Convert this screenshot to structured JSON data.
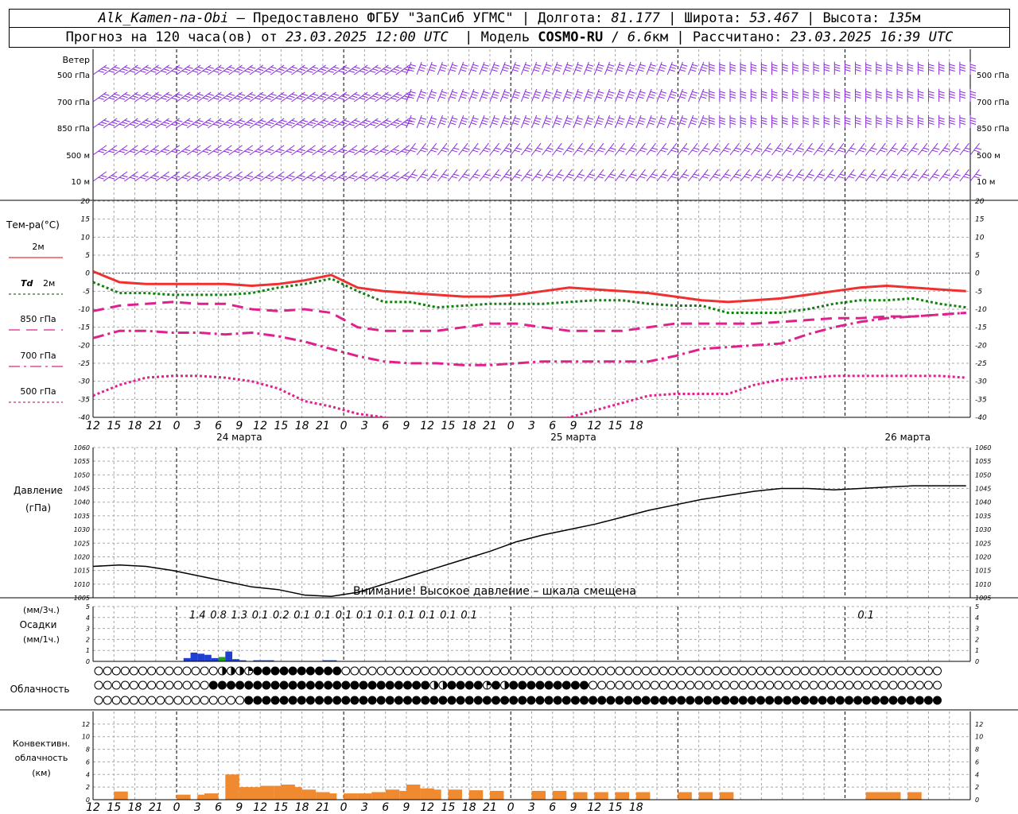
{
  "header": {
    "station": "Alk_Kamen-na-Obi",
    "provided": " – Предоставлено ФГБУ \"ЗапСиб УГМС\" | Долгота: ",
    "lon": "81.177",
    "lat_label": " | Широта: ",
    "lat": "53.467",
    "alt_label": " | Высота: ",
    "alt": "135",
    "alt_unit": "м",
    "forecast": "Прогноз на 120 часа(ов) от ",
    "run": "23.03.2025 12:00 UTC",
    "model_label": "  | Модель ",
    "model": "COSMO-RU",
    "model_sep": " / ",
    "res": "6.6",
    "res_unit": "км",
    "calc_label": " | Рассчитано: ",
    "calc": "23.03.2025 16:39 UTC"
  },
  "colors": {
    "wind": "#8a2be2",
    "t2m": "#f03030",
    "td2m": "#108010",
    "t850": "#e0208c",
    "t700": "#e0208c",
    "t500": "#e0208c",
    "zero_line": "#3050d0",
    "pressure": "#000000",
    "precip": "#1f3fd0",
    "precip_conv": "#20a020",
    "conv_cloud": "#f08a30",
    "grid": "#a8a8a8"
  },
  "chart_data": [
    {
      "type": "wind-barbs",
      "title": "Ветер",
      "levels": [
        "500 гПа",
        "700 гПа",
        "850 гПа",
        "500 м",
        "10 м"
      ],
      "x_hours": [
        12,
        15,
        18,
        21,
        0,
        3,
        6,
        9,
        12,
        15,
        18,
        21,
        0,
        3,
        6,
        9,
        12,
        15,
        18,
        21,
        0,
        3,
        6,
        9,
        12,
        15,
        18
      ]
    },
    {
      "type": "line",
      "title": "Тем-ра(°C)",
      "ylim": [
        -40,
        20
      ],
      "yticks": [
        20,
        15,
        10,
        5,
        0,
        -5,
        -10,
        -15,
        -20,
        -25,
        -30,
        -35,
        -40
      ],
      "x_ticks": [
        "12",
        "15",
        "18",
        "21",
        "0",
        "3",
        "6",
        "9",
        "12",
        "15",
        "18",
        "21",
        "0",
        "3",
        "6",
        "9",
        "12",
        "15",
        "18",
        "21",
        "0",
        "3",
        "6",
        "9",
        "12",
        "15",
        "18"
      ],
      "date_labels": [
        "24 марта",
        "25 марта",
        "26 марта"
      ],
      "legend": [
        {
          "label": "2м",
          "key": "t2m"
        },
        {
          "label": "Td",
          "label2": "2м",
          "key": "td2m"
        },
        {
          "label": "850 гПа",
          "key": "t850"
        },
        {
          "label": "700 гПа",
          "key": "t700"
        },
        {
          "label": "500 гПа",
          "key": "t500"
        }
      ],
      "series": [
        {
          "key": "t2m",
          "style": "solid",
          "values": [
            0.5,
            -2.5,
            -3,
            -3,
            -3,
            -3,
            -3.5,
            -3,
            -2,
            -0.5,
            -4,
            -5,
            -5.5,
            -6,
            -6.5,
            -6.5,
            -6,
            -5,
            -4,
            -4.5,
            -5,
            -5.5,
            -6.5,
            -7.5,
            -8,
            -7.5,
            -7,
            -6,
            -5,
            -4,
            -3.5,
            -4,
            -4.5,
            -5
          ]
        },
        {
          "key": "td2m",
          "style": "dotted",
          "values": [
            -2.5,
            -5.5,
            -5.5,
            -6,
            -6,
            -6,
            -5.5,
            -4,
            -3,
            -1.5,
            -5,
            -8,
            -8,
            -9.5,
            -9,
            -8.5,
            -8.5,
            -8.5,
            -8,
            -7.5,
            -7.5,
            -8.5,
            -9,
            -9,
            -11,
            -11,
            -11,
            -10,
            -8.5,
            -7.5,
            -7.5,
            -7,
            -8.5,
            -9.5
          ]
        },
        {
          "key": "t850",
          "style": "dashed",
          "values": [
            -10.5,
            -9,
            -8.5,
            -8,
            -8.5,
            -8.5,
            -10,
            -10.5,
            -10,
            -11,
            -15,
            -16,
            -16,
            -16,
            -15,
            -14,
            -14,
            -15,
            -16,
            -16,
            -16,
            -15,
            -14,
            -14,
            -14,
            -14,
            -13.5,
            -13,
            -12.5,
            -12.5,
            -12,
            -12,
            -11.5,
            -11
          ]
        },
        {
          "key": "t700",
          "style": "dashdot",
          "values": [
            -18,
            -16,
            -16,
            -16.5,
            -16.5,
            -17,
            -16.5,
            -17.5,
            -19,
            -21,
            -23,
            -24.5,
            -25,
            -25,
            -25.5,
            -25.5,
            -25,
            -24.5,
            -24.5,
            -24.5,
            -24.5,
            -24.5,
            -23,
            -21,
            -20.5,
            -20,
            -19.5,
            -17,
            -15,
            -13.5,
            -12.5,
            -12,
            -11.5,
            -11
          ]
        },
        {
          "key": "t500",
          "style": "dotted",
          "values": [
            -34,
            -31,
            -29,
            -28.5,
            -28.5,
            -29,
            -30,
            -32,
            -35.5,
            -37,
            -39,
            -40,
            -42,
            -44,
            -45,
            -45,
            -44,
            -42,
            -40,
            -38,
            -36,
            -34,
            -33.5,
            -33.5,
            -33.5,
            -31,
            -29.5,
            -29,
            -28.5,
            -28.5,
            -28.5,
            -28.5,
            -28.5,
            -29
          ]
        }
      ]
    },
    {
      "type": "line",
      "title": "Давление",
      "ylabel": "(гПа)",
      "ylim": [
        1005,
        1060
      ],
      "yticks": [
        1060,
        1055,
        1050,
        1045,
        1040,
        1035,
        1030,
        1025,
        1020,
        1015,
        1010,
        1005
      ],
      "warning": "Внимание! Высокое давление – шкала смещена",
      "series": [
        {
          "key": "pressure",
          "values": [
            1016.5,
            1017,
            1016.5,
            1015,
            1013,
            1011,
            1009,
            1008,
            1006,
            1005.5,
            1007,
            1010,
            1013,
            1016,
            1019,
            1022,
            1025.5,
            1028,
            1030,
            1032,
            1034.5,
            1037,
            1039,
            1041,
            1042.5,
            1044,
            1045,
            1045,
            1044.5,
            1045,
            1045.5,
            1046,
            1046,
            1046
          ]
        }
      ]
    },
    {
      "type": "bar",
      "title": "Осадки",
      "ylabel_top": "(мм/3ч.)",
      "ylabel_bottom": "(мм/1ч.)",
      "ylim": [
        0,
        5
      ],
      "yticks": [
        5,
        4,
        3,
        2,
        1,
        0
      ],
      "totals": [
        {
          "h": 15,
          "label": "1.4"
        },
        {
          "h": 18,
          "label": "0.8"
        },
        {
          "h": 21,
          "label": "1.3"
        },
        {
          "h": 24,
          "label": "0.1"
        },
        {
          "h": 27,
          "label": "0.2"
        },
        {
          "h": 30,
          "label": "0.1"
        },
        {
          "h": 33,
          "label": "0.1"
        },
        {
          "h": 36,
          "label": "0.1"
        },
        {
          "h": 39,
          "label": "0.1"
        },
        {
          "h": 42,
          "label": "0.1"
        },
        {
          "h": 45,
          "label": "0.1"
        },
        {
          "h": 48,
          "label": "0.1"
        },
        {
          "h": 51,
          "label": "0.1"
        },
        {
          "h": 54,
          "label": "0.1"
        },
        {
          "h": 111,
          "label": "0.1"
        }
      ],
      "hourly": [
        {
          "h": 13,
          "v": 0.3
        },
        {
          "h": 14,
          "v": 0.8
        },
        {
          "h": 15,
          "v": 0.7
        },
        {
          "h": 16,
          "v": 0.6
        },
        {
          "h": 17,
          "v": 0.3
        },
        {
          "h": 18,
          "v": 0.4,
          "conv": true
        },
        {
          "h": 19,
          "v": 0.9
        },
        {
          "h": 20,
          "v": 0.2
        },
        {
          "h": 21,
          "v": 0.1
        },
        {
          "h": 23,
          "v": 0.1
        },
        {
          "h": 24,
          "v": 0.1
        },
        {
          "h": 25,
          "v": 0.1
        },
        {
          "h": 33,
          "v": 0.1
        },
        {
          "h": 34,
          "v": 0.1
        }
      ]
    },
    {
      "type": "cloud-symbols",
      "title": "Облачность",
      "rows": [
        "000000000000006332444444444400000000000000000000000000000000000000000000000000000000000000000000000000000000000000000000",
        "000000000000044444444444444444444444443344442434444444440000000000000000000000000000000000000000000000000000000000000000222424",
        "000000000000000004444444444444444444444444444444444444444444444444444444444444444444444444444444444444444444444444444444"
      ]
    },
    {
      "type": "bar",
      "title": "Конвективн.",
      "title2": "облачность",
      "ylabel": "(км)",
      "ylim": [
        0,
        14
      ],
      "yticks": [
        12,
        10,
        8,
        6,
        4,
        2,
        0
      ],
      "values": [
        {
          "h": 3,
          "b": 0.5,
          "t": 1.3
        },
        {
          "h": 12,
          "b": 0.5,
          "t": 0.8
        },
        {
          "h": 15,
          "b": 0.5,
          "t": 0.8
        },
        {
          "h": 16,
          "b": 0.5,
          "t": 1.0
        },
        {
          "h": 19,
          "b": 0.5,
          "t": 4.0
        },
        {
          "h": 21,
          "b": 0.5,
          "t": 2.0
        },
        {
          "h": 22,
          "b": 0.5,
          "t": 1.8
        },
        {
          "h": 23,
          "b": 0.5,
          "t": 2.0
        },
        {
          "h": 24,
          "b": 0.5,
          "t": 2.2
        },
        {
          "h": 26,
          "b": 0.5,
          "t": 2.2
        },
        {
          "h": 27,
          "b": 0.5,
          "t": 2.4
        },
        {
          "h": 28,
          "b": 0.5,
          "t": 2.0
        },
        {
          "h": 30,
          "b": 0.5,
          "t": 1.6
        },
        {
          "h": 32,
          "b": 0.5,
          "t": 1.2
        },
        {
          "h": 33,
          "b": 0.5,
          "t": 1.0
        },
        {
          "h": 36,
          "b": 0.5,
          "t": 1.0
        },
        {
          "h": 38,
          "b": 0.5,
          "t": 1.0
        },
        {
          "h": 40,
          "b": 0.5,
          "t": 1.2
        },
        {
          "h": 42,
          "b": 0.5,
          "t": 1.6
        },
        {
          "h": 44,
          "b": 0.5,
          "t": 1.4
        },
        {
          "h": 45,
          "b": 0.5,
          "t": 2.4
        },
        {
          "h": 47,
          "b": 0.5,
          "t": 1.8
        },
        {
          "h": 48,
          "b": 0.5,
          "t": 1.6
        },
        {
          "h": 51,
          "b": 0.5,
          "t": 1.6
        },
        {
          "h": 54,
          "b": 0.5,
          "t": 1.5
        },
        {
          "h": 57,
          "b": 0.5,
          "t": 1.4
        },
        {
          "h": 63,
          "b": 0.5,
          "t": 1.4
        },
        {
          "h": 66,
          "b": 0.5,
          "t": 1.4
        },
        {
          "h": 69,
          "b": 0.5,
          "t": 1.2
        },
        {
          "h": 72,
          "b": 0.5,
          "t": 1.2
        },
        {
          "h": 75,
          "b": 0.5,
          "t": 1.2
        },
        {
          "h": 78,
          "b": 0.5,
          "t": 1.2
        },
        {
          "h": 84,
          "b": 0.5,
          "t": 1.2
        },
        {
          "h": 87,
          "b": 0.5,
          "t": 1.2
        },
        {
          "h": 90,
          "b": 0.5,
          "t": 1.2
        },
        {
          "h": 111,
          "b": 0.5,
          "t": 1.2
        },
        {
          "h": 112,
          "b": 0.5,
          "t": 1.2
        },
        {
          "h": 114,
          "b": 0.5,
          "t": 1.2
        },
        {
          "h": 117,
          "b": 0.5,
          "t": 1.2
        }
      ]
    }
  ]
}
